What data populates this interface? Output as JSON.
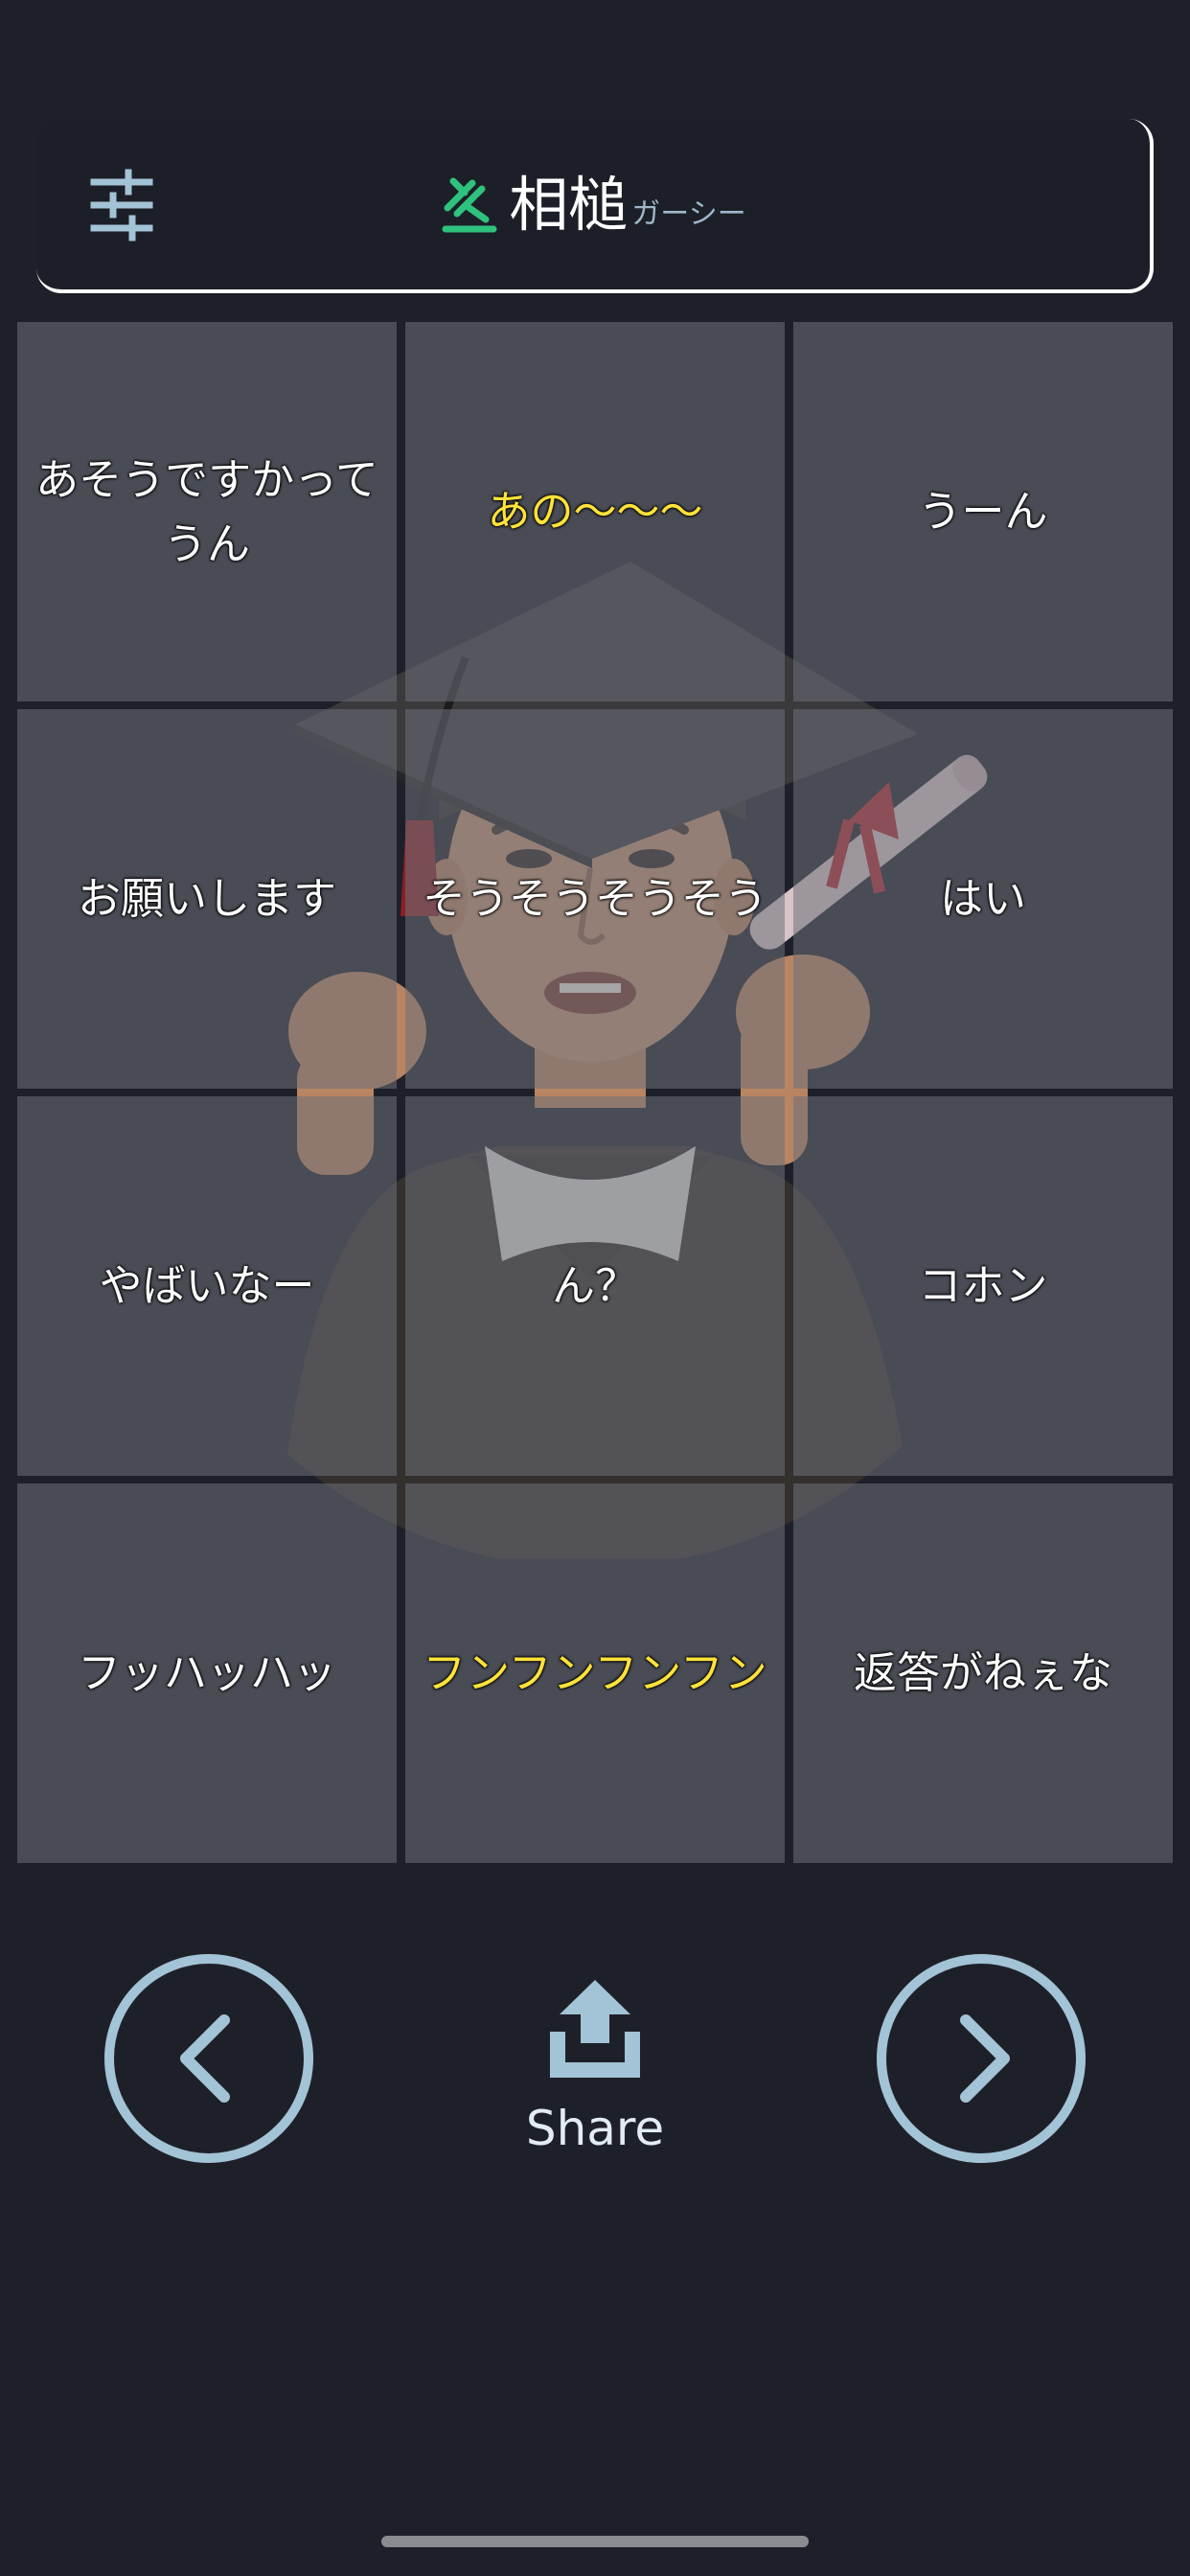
{
  "header": {
    "title": "相槌",
    "subtitle": "ガーシー",
    "settings_icon": "sliders-icon",
    "logo_icon": "gavel-icon"
  },
  "colors": {
    "background": "#1e2029",
    "accent_green": "#2ec27e",
    "control_blue": "#a3c3d6",
    "highlight_yellow": "#ffe23a"
  },
  "grid": {
    "cells": [
      {
        "label": "あそうですかってうん",
        "highlighted": false
      },
      {
        "label": "あの〜〜〜",
        "highlighted": true
      },
      {
        "label": "うーん",
        "highlighted": false
      },
      {
        "label": "お願いします",
        "highlighted": false
      },
      {
        "label": "そうそうそうそう",
        "highlighted": false
      },
      {
        "label": "はい",
        "highlighted": false
      },
      {
        "label": "やばいなー",
        "highlighted": false
      },
      {
        "label": "ん？",
        "highlighted": false
      },
      {
        "label": "コホン",
        "highlighted": false
      },
      {
        "label": "フッハッハッ",
        "highlighted": false
      },
      {
        "label": "フンフンフンフン",
        "highlighted": true
      },
      {
        "label": "返答がねぇな",
        "highlighted": false
      }
    ]
  },
  "controls": {
    "prev_icon": "chevron-left-icon",
    "next_icon": "chevron-right-icon",
    "share_icon": "share-upload-icon",
    "share_label": "Share"
  }
}
